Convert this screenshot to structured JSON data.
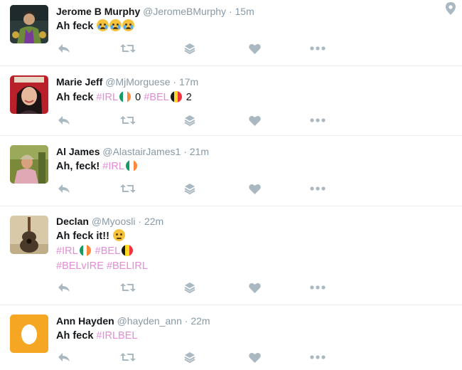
{
  "tweets": [
    {
      "fullname": "Jerome B Murphy",
      "handle": "@JeromeBMurphy",
      "separator": "·",
      "time": "15m",
      "text": "Ah feck"
    },
    {
      "fullname": "Marie Jeff",
      "handle": "@MjMorguese",
      "separator": "·",
      "time": "17m",
      "text": "Ah feck",
      "hashtag1": "#IRL",
      "score1": "0",
      "hashtag2": "#BEL",
      "score2": "2"
    },
    {
      "fullname": "Al James",
      "handle": "@AlastairJames1",
      "separator": "·",
      "time": "21m",
      "text": "Ah, feck!",
      "hashtag1": "#IRL"
    },
    {
      "fullname": "Declan",
      "handle": "@Myoosli",
      "separator": "·",
      "time": "22m",
      "text": "Ah feck it!!",
      "hashtag1": "#IRL",
      "hashtag2": "#BEL",
      "hashtag3": "#BELvIRE",
      "hashtag4": "#BELIRL"
    },
    {
      "fullname": "Ann Hayden",
      "handle": "@hayden_ann",
      "separator": "·",
      "time": "22m",
      "text": "Ah feck",
      "hashtag1": "#IRLBEL"
    }
  ],
  "icons": {
    "reply": "reply-icon",
    "retweet": "retweet-icon",
    "layers": "layers-icon",
    "like": "heart-icon",
    "more": "more-icon",
    "location": "location-pin-icon"
  },
  "colors": {
    "hashtag": "#e48cd6",
    "action_icon": "#aab8c2",
    "muted_text": "#8899a6",
    "divider": "#e6ecf0"
  }
}
